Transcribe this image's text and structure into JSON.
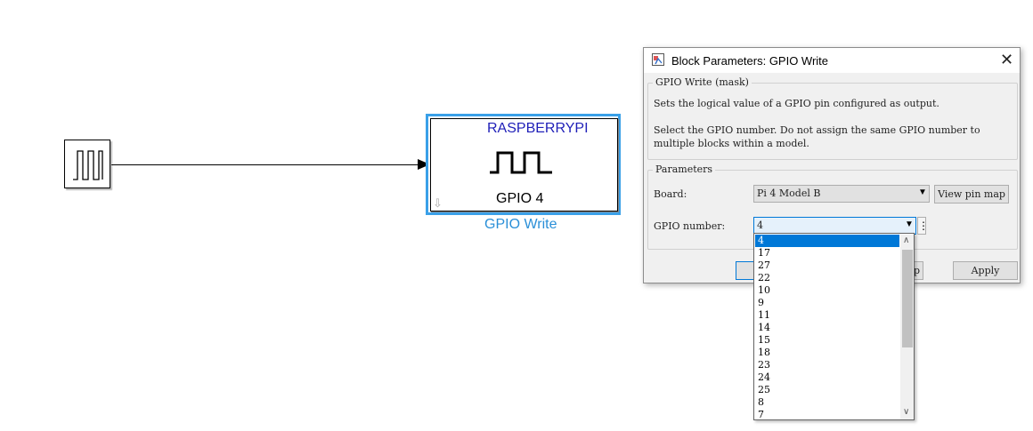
{
  "model": {
    "gpio_block": {
      "vendor": "RASPBERRYPI",
      "pin_label": "GPIO 4",
      "name": "GPIO Write"
    }
  },
  "dialog": {
    "title": "Block Parameters: GPIO Write",
    "mask_legend": "GPIO Write (mask)",
    "description_line1": "Sets the logical value of a GPIO pin configured as output.",
    "description_line2": "Select the GPIO number. Do not assign the same GPIO number to",
    "description_line3": "multiple blocks within a model.",
    "params_legend": "Parameters",
    "board_label": "Board:",
    "board_value": "Pi 4 Model B",
    "view_pin_map": "View pin map",
    "gpio_label": "GPIO number:",
    "gpio_value": "4",
    "more_button": "⋮",
    "ok_partial": "",
    "help_partial": "p",
    "apply": "Apply"
  },
  "dropdown": {
    "options": [
      "4",
      "17",
      "27",
      "22",
      "10",
      "9",
      "11",
      "14",
      "15",
      "18",
      "23",
      "24",
      "25",
      "8",
      "7"
    ],
    "selected_index": 0
  },
  "colors": {
    "selection_outline": "#3aa0e8",
    "vendor_text": "#1f1fb8",
    "block_name": "#2a8fd8",
    "list_highlight": "#0078d7"
  }
}
